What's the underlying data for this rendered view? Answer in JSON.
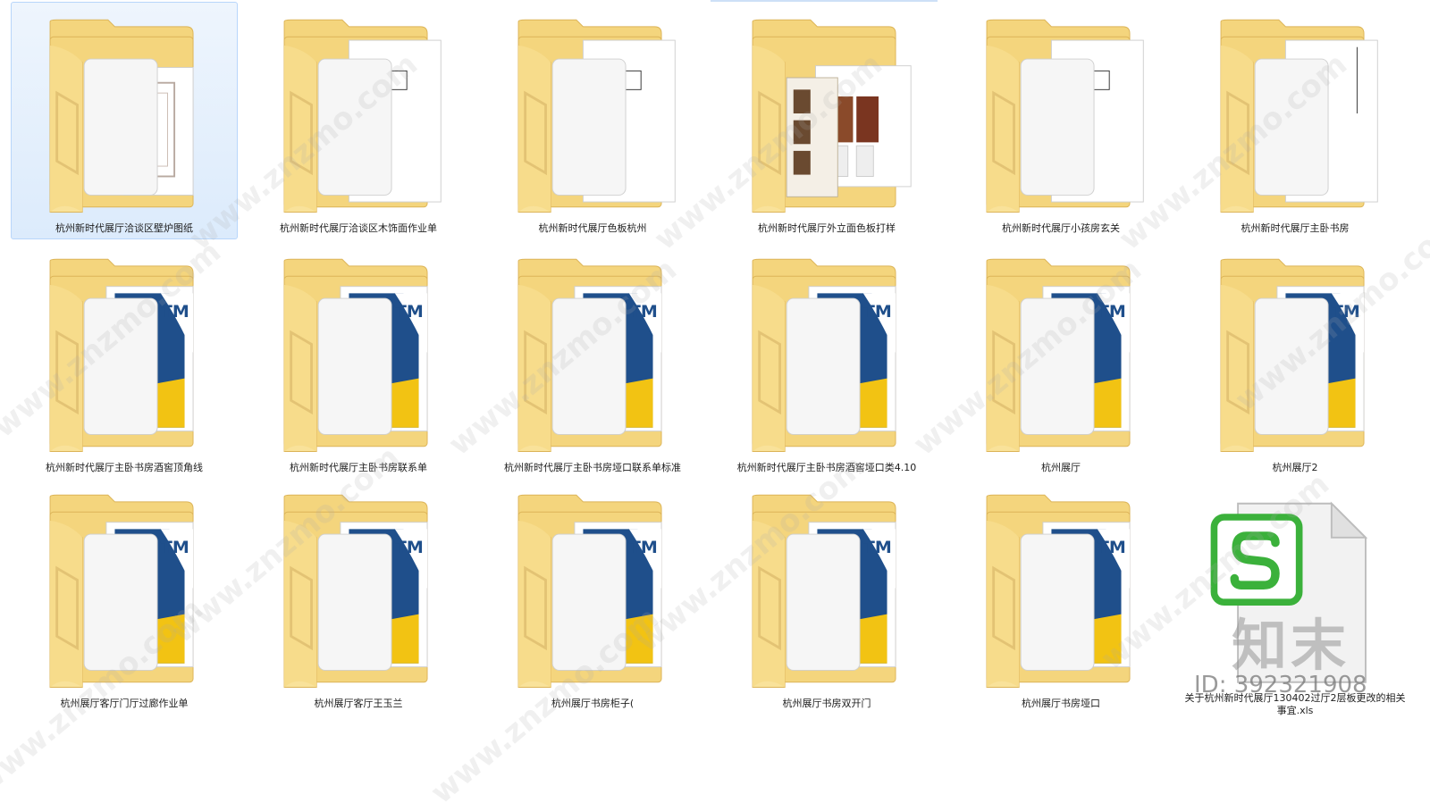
{
  "watermark": {
    "url": "www.znzmo.com",
    "brand": "知末",
    "id_label": "ID: 392321908"
  },
  "colors": {
    "folder_back": "#f4d57d",
    "folder_front": "#f9e29a",
    "selection": "#cfe3fb",
    "blue_doc": "#1f4f8b",
    "yellow_doc": "#f2c313",
    "xls_green": "#3bb13b"
  },
  "items": [
    {
      "label": "杭州新时代展厅洽谈区壁炉图纸",
      "icon": "folder-plan-icon",
      "selected": true
    },
    {
      "label": "杭州新时代展厅洽谈区木饰面作业单",
      "icon": "folder-sheet-icon",
      "selected": false
    },
    {
      "label": "杭州新时代展厅色板杭州",
      "icon": "folder-sheet-icon",
      "selected": false
    },
    {
      "label": "杭州新时代展厅外立面色板打样",
      "icon": "folder-photo-icon",
      "selected": false
    },
    {
      "label": "杭州新时代展厅小孩房玄关",
      "icon": "folder-sheet-icon",
      "selected": false
    },
    {
      "label": "杭州新时代展厅主卧书房",
      "icon": "folder-doc-icon",
      "selected": false
    },
    {
      "label": "杭州新时代展厅主卧书房酒窖顶角线",
      "icon": "folder-tm-icon",
      "selected": false
    },
    {
      "label": "杭州新时代展厅主卧书房联系单",
      "icon": "folder-tm-icon",
      "selected": false
    },
    {
      "label": "杭州新时代展厅主卧书房垭口联系单标准",
      "icon": "folder-tm-icon",
      "selected": false
    },
    {
      "label": "杭州新时代展厅主卧书房酒窖垭口类4.10",
      "icon": "folder-tm-icon",
      "selected": false
    },
    {
      "label": "杭州展厅",
      "icon": "folder-tm-icon",
      "selected": false
    },
    {
      "label": "杭州展厅2",
      "icon": "folder-tm-icon",
      "selected": false
    },
    {
      "label": "杭州展厅客厅门厅过廊作业单",
      "icon": "folder-tm-icon",
      "selected": false
    },
    {
      "label": "杭州展厅客厅王玉兰",
      "icon": "folder-tm-icon",
      "selected": false
    },
    {
      "label": "杭州展厅书房柜子(",
      "icon": "folder-tm-icon",
      "selected": false
    },
    {
      "label": "杭州展厅书房双开门",
      "icon": "folder-tm-icon",
      "selected": false
    },
    {
      "label": "杭州展厅书房垭口",
      "icon": "folder-tm-icon",
      "selected": false
    },
    {
      "label": "关于杭州新时代展厅130402过厅2层板更改的相关事宜.xls",
      "icon": "spreadsheet-file-icon",
      "selected": false
    }
  ]
}
